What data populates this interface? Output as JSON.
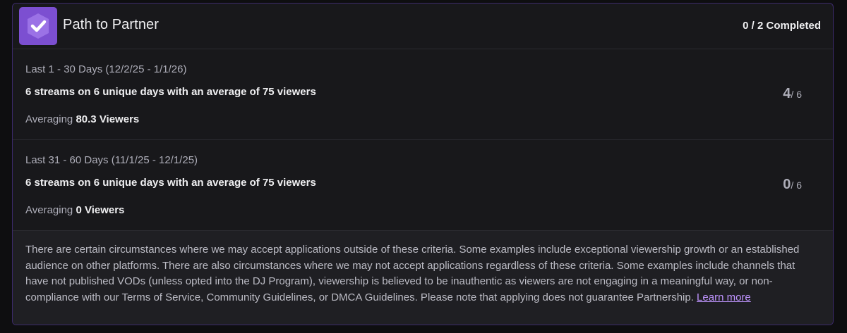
{
  "header": {
    "title": "Path to Partner",
    "status": "0 / 2 Completed",
    "badge_icon": "partner-check-shield-icon",
    "accent_color": "#7c4fd1"
  },
  "periods": [
    {
      "range": "Last 1 - 30 Days (12/2/25 - 1/1/26)",
      "requirement": "6 streams on 6 unique days with an average of 75 viewers",
      "averaging_label": "Averaging",
      "averaging_value": "80.3 Viewers",
      "progress_value": "4",
      "progress_total": "/ 6"
    },
    {
      "range": "Last 31 - 60 Days (11/1/25 - 12/1/25)",
      "requirement": "6 streams on 6 unique days with an average of 75 viewers",
      "averaging_label": "Averaging",
      "averaging_value": "0 Viewers",
      "progress_value": "0",
      "progress_total": "/ 6"
    }
  ],
  "note": {
    "text": "There are certain circumstances where we may accept applications outside of these criteria. Some examples include exceptional viewership growth or an established audience on other platforms. There are also circumstances where we may not accept applications regardless of these criteria. Some examples include channels that have not published VODs (unless opted into the DJ Program), viewership is believed to be inauthentic as viewers are not engaging in a meaningful way, or non-compliance with our Terms of Service, Community Guidelines, or DMCA Guidelines. Please note that applying does not guarantee Partnership.",
    "link_label": "Learn more",
    "link_color": "#bf94ff"
  }
}
